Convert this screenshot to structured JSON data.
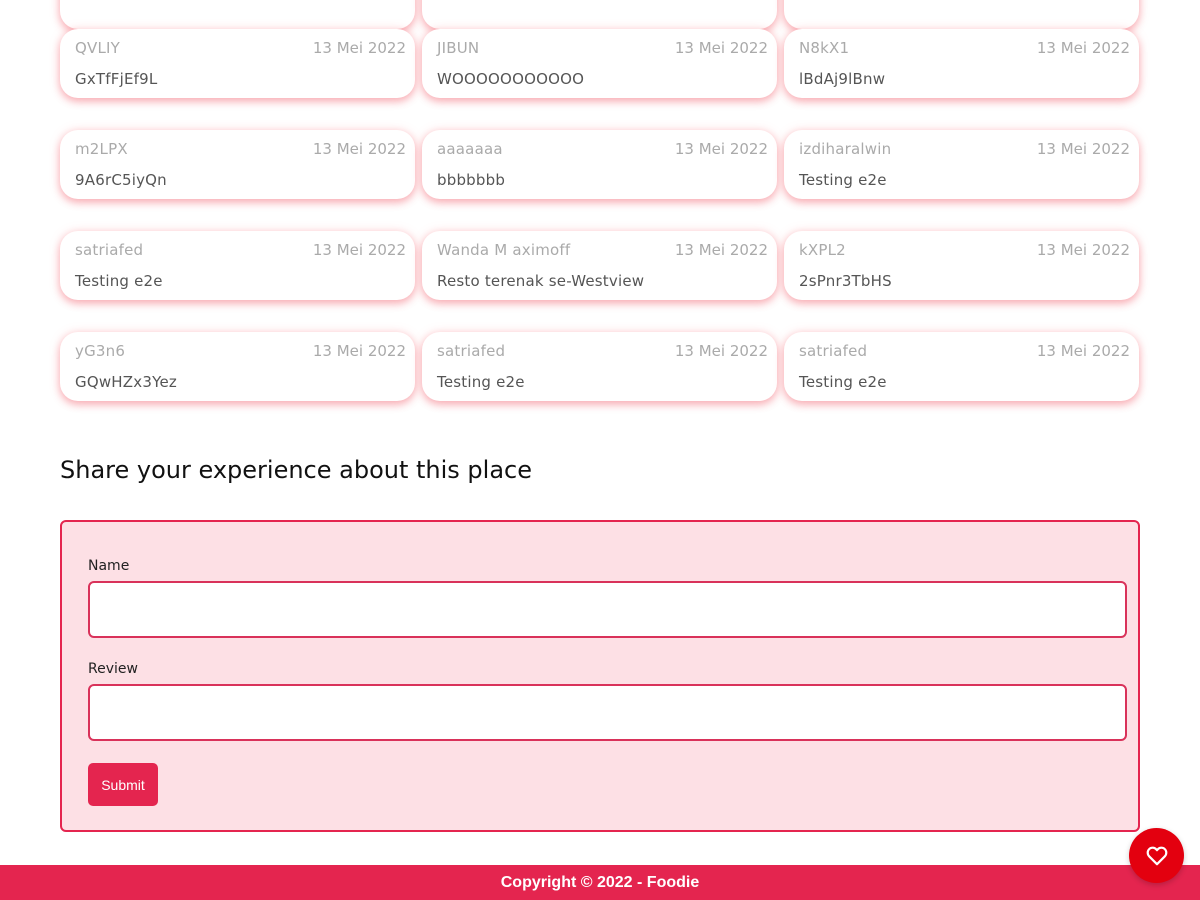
{
  "reviews": [
    {
      "name": "QVLIY",
      "date": "13 Mei 2022",
      "review": "GxTfFjEf9L"
    },
    {
      "name": "JIBUN",
      "date": "13 Mei 2022",
      "review": "WOOOOOOOOOOO"
    },
    {
      "name": "N8kX1",
      "date": "13 Mei 2022",
      "review": "lBdAj9lBnw"
    },
    {
      "name": "m2LPX",
      "date": "13 Mei 2022",
      "review": "9A6rC5iyQn"
    },
    {
      "name": "aaaaaaa",
      "date": "13 Mei 2022",
      "review": "bbbbbbb"
    },
    {
      "name": "izdiharalwin",
      "date": "13 Mei 2022",
      "review": "Testing e2e"
    },
    {
      "name": "satriafed",
      "date": "13 Mei 2022",
      "review": "Testing e2e"
    },
    {
      "name": "Wanda M aximoff",
      "date": "13 Mei 2022",
      "review": "Resto terenak se-Westview"
    },
    {
      "name": "kXPL2",
      "date": "13 Mei 2022",
      "review": "2sPnr3TbHS"
    },
    {
      "name": "yG3n6",
      "date": "13 Mei 2022",
      "review": "GQwHZx3Yez"
    },
    {
      "name": "satriafed",
      "date": "13 Mei 2022",
      "review": "Testing e2e"
    },
    {
      "name": "satriafed",
      "date": "13 Mei 2022",
      "review": "Testing e2e"
    }
  ],
  "form": {
    "title": "Share your experience about this place",
    "name_label": "Name",
    "name_value": "",
    "review_label": "Review",
    "review_value": "",
    "submit_label": "Submit"
  },
  "footer": {
    "copyright": "Copyright © 2022 - Foodie"
  },
  "fab": {
    "icon": "heart-outline-icon"
  },
  "colors": {
    "accent": "#e4254f",
    "form_bg": "#fde0e5",
    "fab_bg": "#e3000f"
  }
}
